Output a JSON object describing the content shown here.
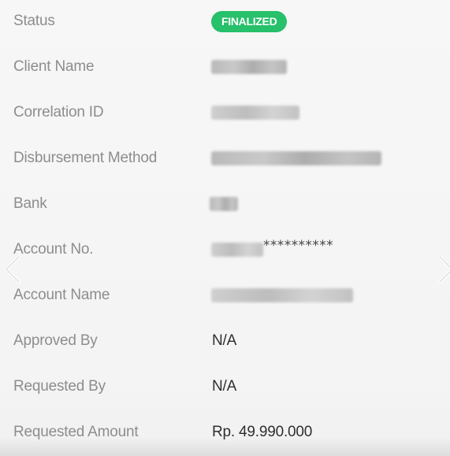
{
  "details": {
    "status": {
      "label": "Status",
      "value": "FINALIZED",
      "color": "#27c06b"
    },
    "client_name": {
      "label": "Client Name"
    },
    "correlation_id": {
      "label": "Correlation ID"
    },
    "disbursement_method": {
      "label": "Disbursement Method"
    },
    "bank": {
      "label": "Bank"
    },
    "account_no": {
      "label": "Account No.",
      "masked_suffix": "**********"
    },
    "account_name": {
      "label": "Account Name"
    },
    "approved_by": {
      "label": "Approved By",
      "value": "N/A"
    },
    "requested_by": {
      "label": "Requested By",
      "value": "N/A"
    },
    "requested_amount": {
      "label": "Requested Amount",
      "value": "Rp. 49.990.000"
    }
  },
  "nav": {
    "prev_icon": "chevron-left-icon",
    "next_icon": "chevron-right-icon"
  }
}
